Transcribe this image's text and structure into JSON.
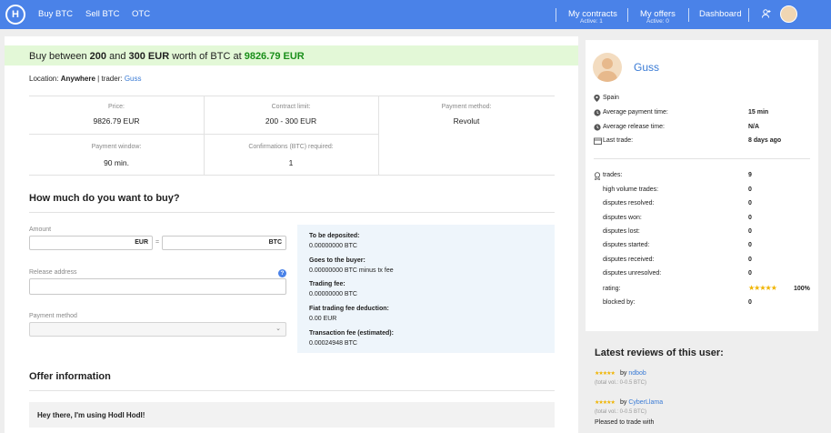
{
  "nav": {
    "logo": "H",
    "buy": "Buy BTC",
    "sell": "Sell BTC",
    "otc": "OTC",
    "my_contracts": "My contracts",
    "my_contracts_sub": "Active: 1",
    "my_offers": "My offers",
    "my_offers_sub": "Active: 0",
    "dashboard": "Dashboard"
  },
  "offer": {
    "h_prefix": "Buy between",
    "h_min": "200",
    "h_and": "and",
    "h_max": "300 EUR",
    "h_mid": "worth of BTC at",
    "h_price": "9826.79 EUR",
    "location_label": "Location:",
    "location": "Anywhere",
    "trader_label": "| trader:",
    "trader": "Guss"
  },
  "details": {
    "price_label": "Price:",
    "price": "9826.79 EUR",
    "limit_label": "Contract limit:",
    "limit": "200 - 300 EUR",
    "method_label": "Payment method:",
    "method": "Revolut",
    "window_label": "Payment window:",
    "window": "90 min.",
    "confirm_label": "Confirmations (BTC) required:",
    "confirm": "1"
  },
  "buy_form": {
    "title": "How much do you want to buy?",
    "amount_label": "Amount",
    "eur": "EUR",
    "eq": "=",
    "btc": "BTC",
    "release_label": "Release address",
    "help": "?",
    "payment_label": "Payment method",
    "chevron": "⌄"
  },
  "summary": {
    "deposit_label": "To be deposited:",
    "deposit": "0.00000000 BTC",
    "buyer_label": "Goes to the buyer:",
    "buyer": "0.00000000 BTC minus tx fee",
    "fee_label": "Trading fee:",
    "fee": "0.00000000 BTC",
    "fiat_label": "Fiat trading fee deduction:",
    "fiat": "0.00 EUR",
    "tx_label": "Transaction fee (estimated):",
    "tx": "0.00024948 BTC"
  },
  "offer_info": {
    "title": "Offer information",
    "greeting": "Hey there, I'm using Hodl Hodl!"
  },
  "profile": {
    "name": "Guss",
    "country": "Spain",
    "avg_pay_label": "Average payment time:",
    "avg_pay": "15 min",
    "avg_rel_label": "Average release time:",
    "avg_rel": "N/A",
    "last_trade_label": "Last trade:",
    "last_trade": "8 days ago",
    "trades_label": "trades:",
    "trades": "9",
    "stats": [
      {
        "label": "high volume trades:",
        "value": "0"
      },
      {
        "label": "disputes resolved:",
        "value": "0"
      },
      {
        "label": "disputes won:",
        "value": "0"
      },
      {
        "label": "disputes lost:",
        "value": "0"
      },
      {
        "label": "disputes started:",
        "value": "0"
      },
      {
        "label": "disputes received:",
        "value": "0"
      },
      {
        "label": "disputes unresolved:",
        "value": "0"
      }
    ],
    "rating_label": "rating:",
    "rating_stars": "★★★★★",
    "rating_pct": "100%",
    "blocked_label": "blocked by:",
    "blocked": "0"
  },
  "reviews": {
    "title": "Latest reviews of this user:",
    "items": [
      {
        "stars": "★★★★★",
        "by": "by",
        "user": "ndbob",
        "vol": "(total vol.: 0-0.5 BTC)",
        "text": ""
      },
      {
        "stars": "★★★★★",
        "by": "by",
        "user": "CyberLlama",
        "vol": "(total vol.: 0-0.5 BTC)",
        "text": "Pleased to trade with"
      }
    ]
  },
  "colors": {
    "nav": "#4a82e8",
    "green": "#1a8f1a",
    "link": "#3a7bd5",
    "star": "#f0b400"
  }
}
